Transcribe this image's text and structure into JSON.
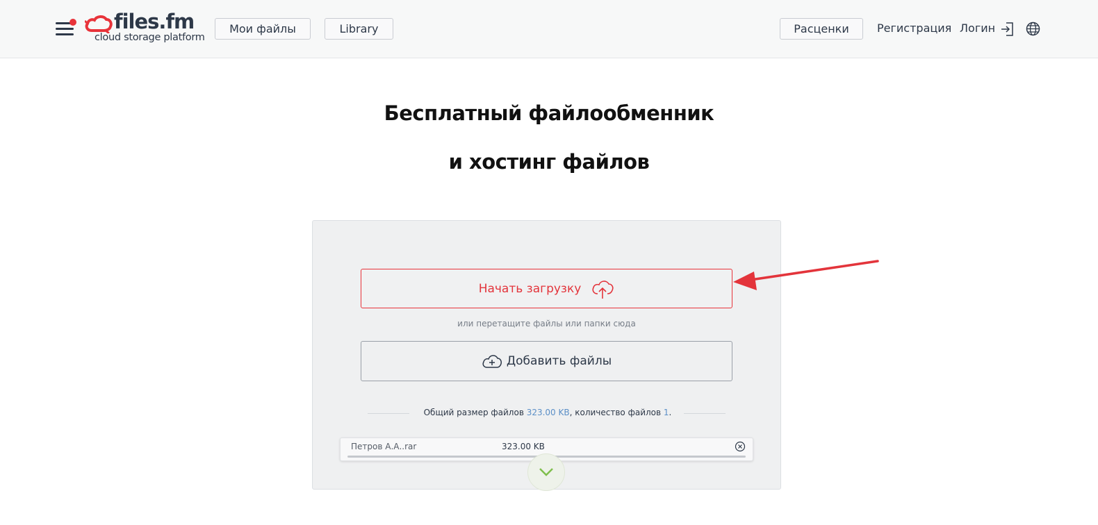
{
  "header": {
    "logo_name": "files.fm",
    "logo_tagline": "cloud storage platform",
    "my_files_label": "Мои файлы",
    "library_label": "Library",
    "pricing_label": "Расценки",
    "register_label": "Регистрация",
    "login_label": "Логин"
  },
  "hero": {
    "title_line1": "Бесплатный файлообменник",
    "title_line2": "и хостинг файлов"
  },
  "upload": {
    "start_label": "Начать загрузку",
    "drop_hint": "или перетащите файлы или папки сюда",
    "add_files_label": "Добавить файлы",
    "summary_prefix": "Общий размер файлов ",
    "summary_size": "323.00 KB",
    "summary_middle": ", количество файлов ",
    "summary_count": "1",
    "summary_suffix": "."
  },
  "files": [
    {
      "name": "Петров А.А..rar",
      "size": "323.00 KB",
      "progress": 1.0
    }
  ],
  "colors": {
    "accent": "#e8333a",
    "text": "#2d3848",
    "link_value": "#5b8fc7",
    "panel_bg": "#eff0f1",
    "scroll_chevron": "#7fbf4d"
  }
}
